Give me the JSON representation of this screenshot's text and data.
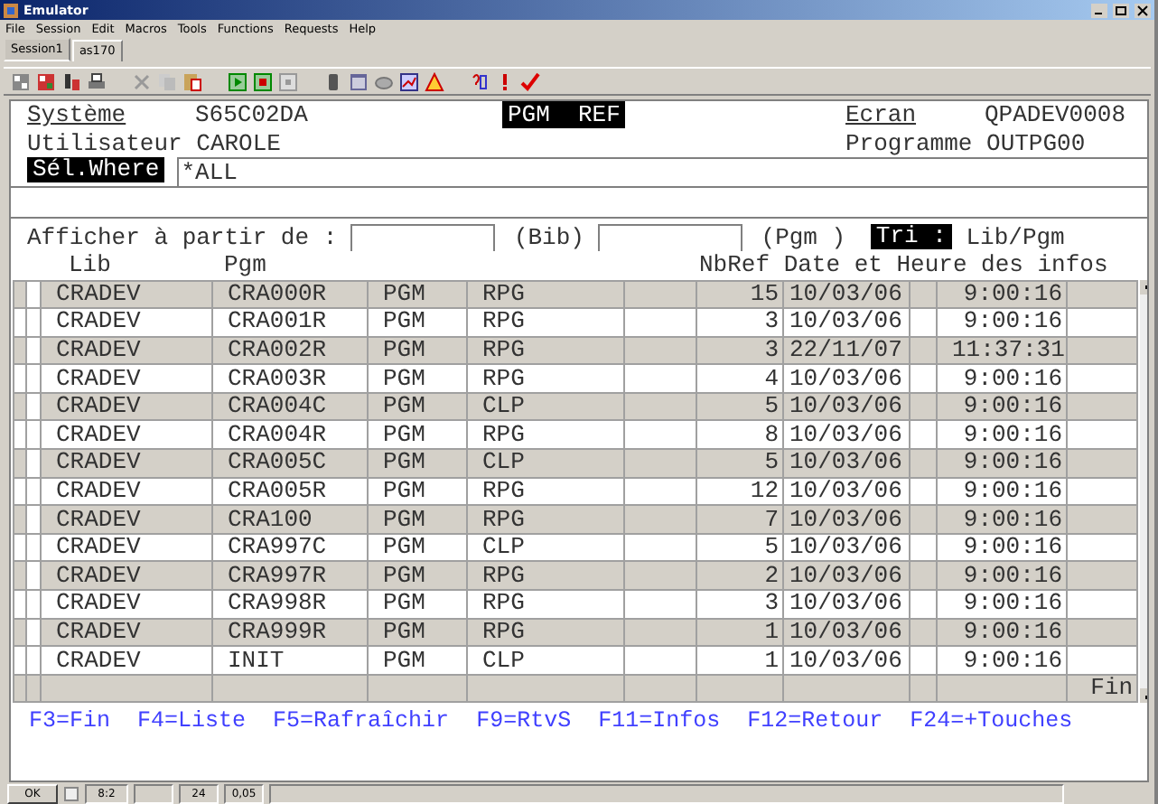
{
  "window": {
    "title": "Emulator"
  },
  "menu": [
    "File",
    "Session",
    "Edit",
    "Macros",
    "Tools",
    "Functions",
    "Requests",
    "Help"
  ],
  "tabs": [
    {
      "label": "Session1",
      "selected": false
    },
    {
      "label": "as170",
      "selected": true
    }
  ],
  "header": {
    "system_label": "Système",
    "system": "S65C02DA",
    "screen_title": "PGM  REF",
    "screen_label": "Ecran",
    "screen": "QPADEV0008",
    "user_label": "Utilisateur",
    "user": "CAROLE",
    "program_label": "Programme",
    "program": "OUTPG00",
    "where_label": "Sél.Where",
    "where_value": "*ALL"
  },
  "filter": {
    "label": "Afficher à partir de :",
    "lib_hint": "(Bib)",
    "pgm_hint": "(Pgm )",
    "sort_label": "Tri :",
    "sort_value": "Lib/Pgm"
  },
  "table": {
    "columns": [
      "Lib",
      "Pgm",
      "NbRef",
      "Date et Heure des infos"
    ],
    "rows": [
      {
        "lib": "CRADEV",
        "pgm": "CRA000R",
        "type": "PGM",
        "attr": "RPG",
        "nbref": "15",
        "date": "10/03/06",
        "time": "9:00:16"
      },
      {
        "lib": "CRADEV",
        "pgm": "CRA001R",
        "type": "PGM",
        "attr": "RPG",
        "nbref": "3",
        "date": "10/03/06",
        "time": "9:00:16"
      },
      {
        "lib": "CRADEV",
        "pgm": "CRA002R",
        "type": "PGM",
        "attr": "RPG",
        "nbref": "3",
        "date": "22/11/07",
        "time": "11:37:31"
      },
      {
        "lib": "CRADEV",
        "pgm": "CRA003R",
        "type": "PGM",
        "attr": "RPG",
        "nbref": "4",
        "date": "10/03/06",
        "time": "9:00:16"
      },
      {
        "lib": "CRADEV",
        "pgm": "CRA004C",
        "type": "PGM",
        "attr": "CLP",
        "nbref": "5",
        "date": "10/03/06",
        "time": "9:00:16"
      },
      {
        "lib": "CRADEV",
        "pgm": "CRA004R",
        "type": "PGM",
        "attr": "RPG",
        "nbref": "8",
        "date": "10/03/06",
        "time": "9:00:16"
      },
      {
        "lib": "CRADEV",
        "pgm": "CRA005C",
        "type": "PGM",
        "attr": "CLP",
        "nbref": "5",
        "date": "10/03/06",
        "time": "9:00:16"
      },
      {
        "lib": "CRADEV",
        "pgm": "CRA005R",
        "type": "PGM",
        "attr": "RPG",
        "nbref": "12",
        "date": "10/03/06",
        "time": "9:00:16"
      },
      {
        "lib": "CRADEV",
        "pgm": "CRA100",
        "type": "PGM",
        "attr": "RPG",
        "nbref": "7",
        "date": "10/03/06",
        "time": "9:00:16"
      },
      {
        "lib": "CRADEV",
        "pgm": "CRA997C",
        "type": "PGM",
        "attr": "CLP",
        "nbref": "5",
        "date": "10/03/06",
        "time": "9:00:16"
      },
      {
        "lib": "CRADEV",
        "pgm": "CRA997R",
        "type": "PGM",
        "attr": "RPG",
        "nbref": "2",
        "date": "10/03/06",
        "time": "9:00:16"
      },
      {
        "lib": "CRADEV",
        "pgm": "CRA998R",
        "type": "PGM",
        "attr": "RPG",
        "nbref": "3",
        "date": "10/03/06",
        "time": "9:00:16"
      },
      {
        "lib": "CRADEV",
        "pgm": "CRA999R",
        "type": "PGM",
        "attr": "RPG",
        "nbref": "1",
        "date": "10/03/06",
        "time": "9:00:16"
      },
      {
        "lib": "CRADEV",
        "pgm": "INIT",
        "type": "PGM",
        "attr": "CLP",
        "nbref": "1",
        "date": "10/03/06",
        "time": "9:00:16"
      }
    ],
    "footer": "Fin"
  },
  "function_keys": [
    "F3=Fin",
    "F4=Liste",
    "F5=Rafraîchir",
    "F9=RtvS",
    "F11=Infos",
    "F12=Retour",
    "F24=+Touches"
  ],
  "status_bar": {
    "button": "OK",
    "cursor": "8:2",
    "rows": "24",
    "time": "0,05"
  }
}
